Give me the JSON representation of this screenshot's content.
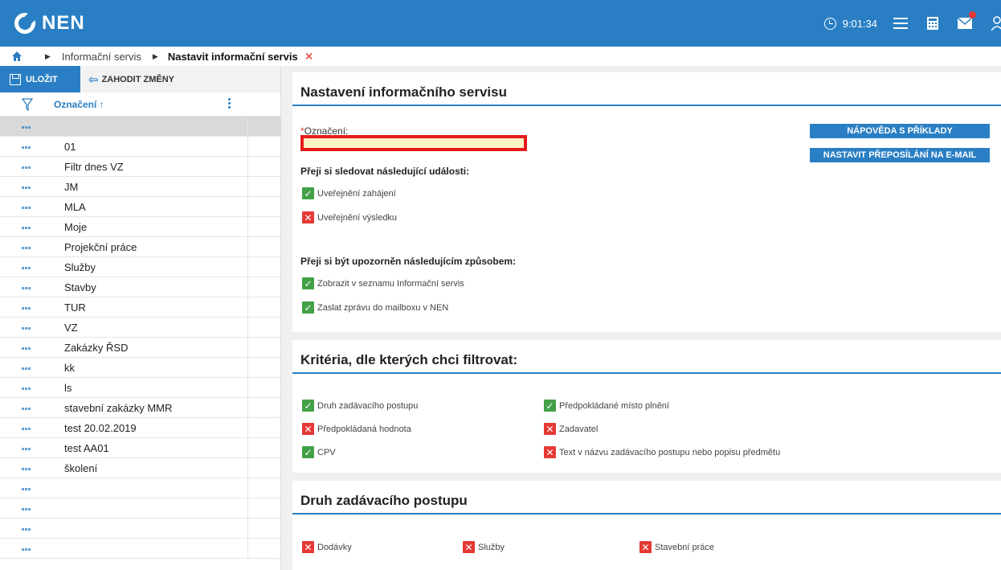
{
  "app": {
    "logo_text": "NEN"
  },
  "topbar": {
    "time": "9:01:34",
    "brand_color": "#2a7fc4"
  },
  "breadcrumb": {
    "parent": "Informační servis",
    "current": "Nastavit informační servis",
    "close_glyph": "✕"
  },
  "toolbar": {
    "save_label": "ULOŽIT",
    "discard_label": "ZAHODIT ZMĚNY"
  },
  "list": {
    "column_title": "Označení",
    "sort_glyph": "↑",
    "items": [
      "",
      "01",
      "Filtr dnes VZ",
      "JM",
      "MLA",
      "Moje",
      "Projekční práce",
      "Služby",
      "Stavby",
      "TUR",
      "VZ",
      "Zakázky ŘSD",
      "kk",
      "ls",
      "stavební zakázky MMR",
      "test 20.02.2019",
      "test AA01",
      "školení",
      "",
      "",
      "",
      ""
    ]
  },
  "settings": {
    "title": "Nastavení informačního servisu",
    "field_label": "Označení:",
    "required_mark": "*",
    "field_value": "",
    "help_button": "NÁPOVĚDA S PŘÍKLADY",
    "forward_button": "NASTAVIT PŘEPOSÍLÁNÍ NA E-MAIL",
    "events_heading": "Přeji si sledovat následující události:",
    "events": [
      {
        "label": "Uveřejnění zahájení",
        "checked": true
      },
      {
        "label": "Uveřejnění výsledku",
        "checked": false
      }
    ],
    "notify_heading": "Přeji si být upozorněn následujícím způsobem:",
    "notify": [
      {
        "label": "Zobrazit v seznamu Informační servis",
        "checked": true
      },
      {
        "label": "Zaslat zprávu do mailboxu v NEN",
        "checked": true
      }
    ]
  },
  "criteria": {
    "title": "Kritéria, dle kterých chci filtrovat:",
    "items": [
      {
        "label": "Druh zadávacího postupu",
        "checked": true
      },
      {
        "label": "Předpokládané místo plnění",
        "checked": true
      },
      {
        "label": "Předpokládaná hodnota",
        "checked": false
      },
      {
        "label": "Zadavatel",
        "checked": false
      },
      {
        "label": "CPV",
        "checked": true
      },
      {
        "label": "Text v názvu zadávacího postupu nebo popisu předmětu",
        "checked": false
      }
    ]
  },
  "procedure": {
    "title": "Druh zadávacího postupu",
    "items": [
      {
        "label": "Dodávky",
        "checked": false
      },
      {
        "label": "Služby",
        "checked": false
      },
      {
        "label": "Stavební práce",
        "checked": false
      }
    ]
  }
}
